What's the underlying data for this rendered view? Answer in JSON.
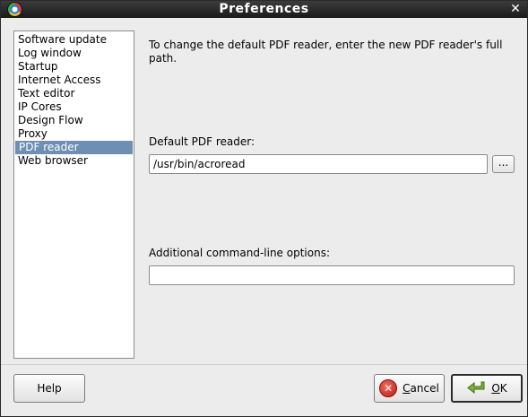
{
  "window": {
    "title": "Preferences"
  },
  "sidebar": {
    "items": [
      {
        "label": "Software update"
      },
      {
        "label": "Log window"
      },
      {
        "label": "Startup"
      },
      {
        "label": "Internet Access"
      },
      {
        "label": "Text editor"
      },
      {
        "label": "IP Cores"
      },
      {
        "label": "Design Flow"
      },
      {
        "label": "Proxy"
      },
      {
        "label": "PDF reader",
        "selected": true
      },
      {
        "label": "Web browser"
      }
    ]
  },
  "main": {
    "description": "To change the default PDF reader, enter the new PDF reader's full path.",
    "reader_label": "Default PDF reader:",
    "reader_value": "/usr/bin/acroread",
    "browse_label": "...",
    "options_label": "Additional command-line options:",
    "options_value": ""
  },
  "buttons": {
    "help": "Help",
    "cancel_mnemonic": "C",
    "cancel_rest": "ancel",
    "ok_mnemonic": "O",
    "ok_rest": "K"
  },
  "colors": {
    "selection": "#6e8fb3",
    "titlebar": "#1a1a1a"
  }
}
